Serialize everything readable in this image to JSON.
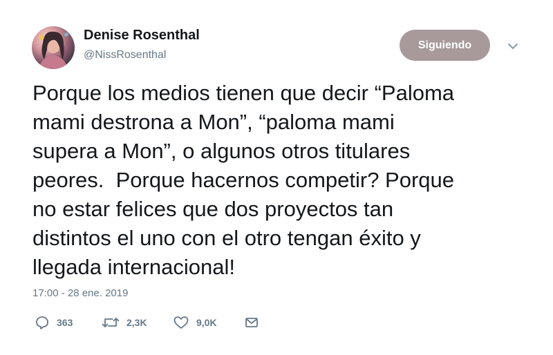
{
  "user": {
    "display_name": "Denise Rosenthal",
    "handle": "@NissRosenthal"
  },
  "follow_button": {
    "label": "Siguiendo"
  },
  "tweet": {
    "lines": [
      "Porque los medios tienen que decir “Paloma",
      "mami destrona a Mon”, “paloma mami",
      "supera a Mon”, o algunos otros titulares",
      "peores.  Porque hacernos competir? Porque",
      "no estar felices que dos proyectos tan",
      "distintos el uno con el otro tengan éxito y",
      "llegada internacional!"
    ],
    "timestamp": "17:00 - 28 ene. 2019"
  },
  "actions": {
    "replies": {
      "icon": "reply-icon",
      "count": "363"
    },
    "retweets": {
      "icon": "retweet-icon",
      "count": "2,3K"
    },
    "likes": {
      "icon": "heart-icon",
      "count": "9,0K"
    },
    "message": {
      "icon": "envelope-icon"
    }
  },
  "colors": {
    "follow_button_bg": "#a89a9b",
    "secondary_text": "#657786",
    "primary_text": "#14171a"
  }
}
